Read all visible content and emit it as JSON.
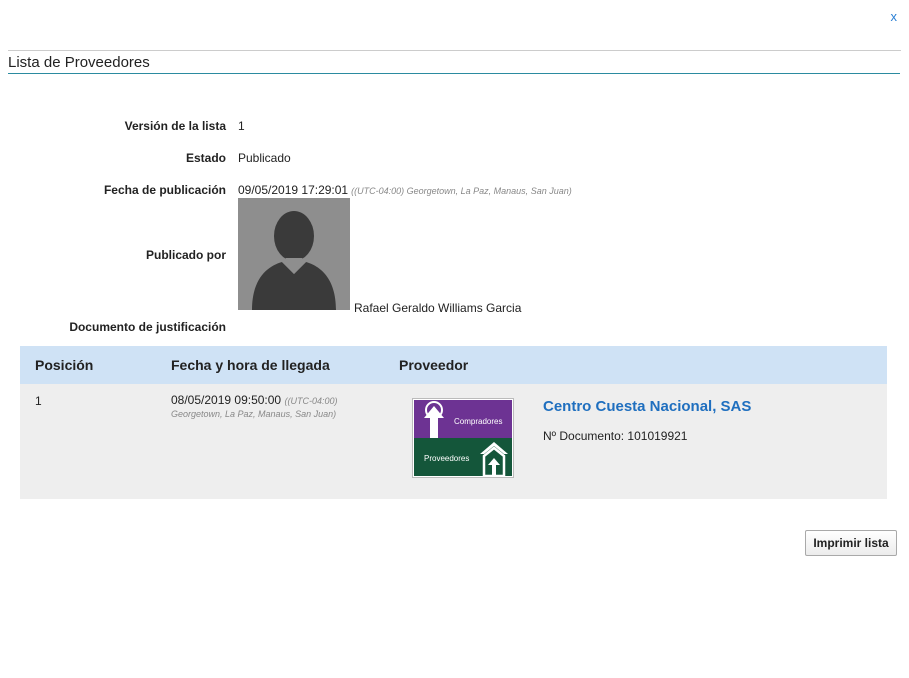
{
  "modal": {
    "close_label": "x",
    "section_title": "Lista de Proveedores"
  },
  "info": {
    "version_label": "Versión de la lista",
    "version_value": "1",
    "estado_label": "Estado",
    "estado_value": "Publicado",
    "fecha_label": "Fecha de publicación",
    "fecha_value": "09/05/2019 17:29:01",
    "fecha_tz": "((UTC-04:00) Georgetown, La Paz, Manaus, San Juan)",
    "publicado_label": "Publicado por",
    "publicado_name": "Rafael Geraldo Williams Garcia",
    "doc_label": "Documento de justificación"
  },
  "table": {
    "headers": [
      "Posición",
      "Fecha y hora de llegada",
      "Proveedor"
    ],
    "rows": [
      {
        "position": "1",
        "date": "08/05/2019 09:50:00",
        "tz_line1": "((UTC-04:00)",
        "tz_line2": "Georgetown, La Paz, Manaus, San Juan)",
        "logo_top": "Compradores",
        "logo_bottom": "Proveedores",
        "company": "Centro Cuesta Nacional, SAS",
        "doc_number": "Nº Documento: 101019921"
      }
    ]
  },
  "actions": {
    "print_label": "Imprimir lista"
  },
  "colors": {
    "link": "#1f6fbf",
    "header_bg": "#cfe2f5",
    "row_bg": "#eeeeee",
    "logo_purple": "#6d3393",
    "logo_green": "#14563a"
  },
  "icons": {
    "avatar": "user-silhouette-icon",
    "logo": "buyer-supplier-logo"
  }
}
